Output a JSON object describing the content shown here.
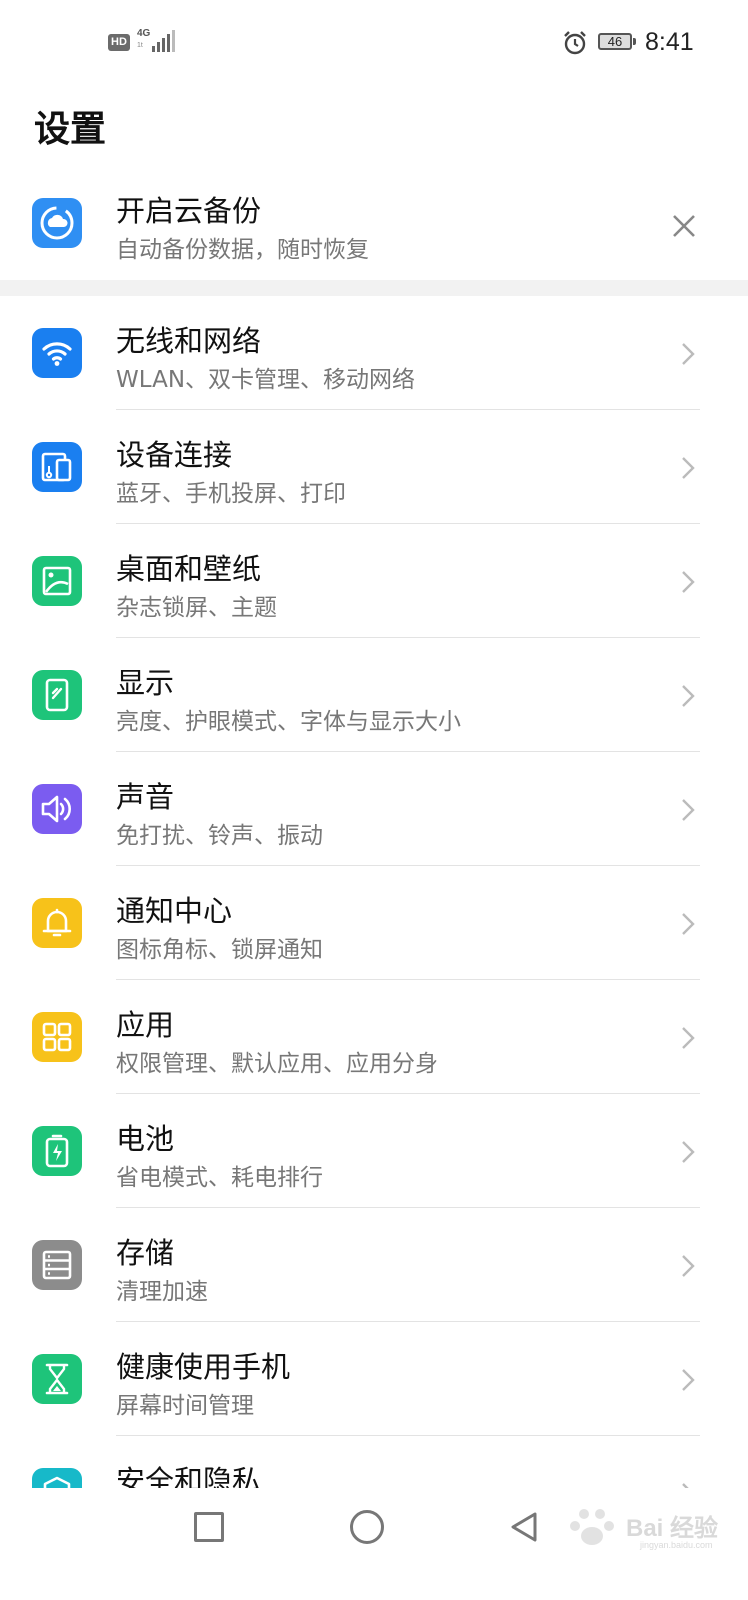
{
  "status_bar": {
    "hd": "HD",
    "network": "4G",
    "network_sub": "1t",
    "battery": "46",
    "time": "8:41"
  },
  "page": {
    "title": "设置"
  },
  "backup_card": {
    "title": "开启云备份",
    "subtitle": "自动备份数据，随时恢复"
  },
  "settings": [
    {
      "title": "无线和网络",
      "subtitle": "WLAN、双卡管理、移动网络",
      "icon": "wifi-icon",
      "color": "#1a7ff0"
    },
    {
      "title": "设备连接",
      "subtitle": "蓝牙、手机投屏、打印",
      "icon": "device-connect-icon",
      "color": "#1a7ff0"
    },
    {
      "title": "桌面和壁纸",
      "subtitle": "杂志锁屏、主题",
      "icon": "wallpaper-icon",
      "color": "#1ec47a"
    },
    {
      "title": "显示",
      "subtitle": "亮度、护眼模式、字体与显示大小",
      "icon": "display-icon",
      "color": "#1ec47a"
    },
    {
      "title": "声音",
      "subtitle": "免打扰、铃声、振动",
      "icon": "sound-icon",
      "color": "#7b5cf0"
    },
    {
      "title": "通知中心",
      "subtitle": "图标角标、锁屏通知",
      "icon": "bell-icon",
      "color": "#f7c21a"
    },
    {
      "title": "应用",
      "subtitle": "权限管理、默认应用、应用分身",
      "icon": "apps-grid-icon",
      "color": "#f7c21a"
    },
    {
      "title": "电池",
      "subtitle": "省电模式、耗电排行",
      "icon": "battery-icon",
      "color": "#1ec47a"
    },
    {
      "title": "存储",
      "subtitle": "清理加速",
      "icon": "storage-icon",
      "color": "#8c8c8c"
    },
    {
      "title": "健康使用手机",
      "subtitle": "屏幕时间管理",
      "icon": "hourglass-icon",
      "color": "#1ec47a"
    },
    {
      "title": "安全和隐私",
      "subtitle": "",
      "icon": "shield-icon",
      "color": "#17b9c9"
    }
  ],
  "watermark": {
    "text": "Bai 经验",
    "sub": "jingyan.baidu.com"
  }
}
